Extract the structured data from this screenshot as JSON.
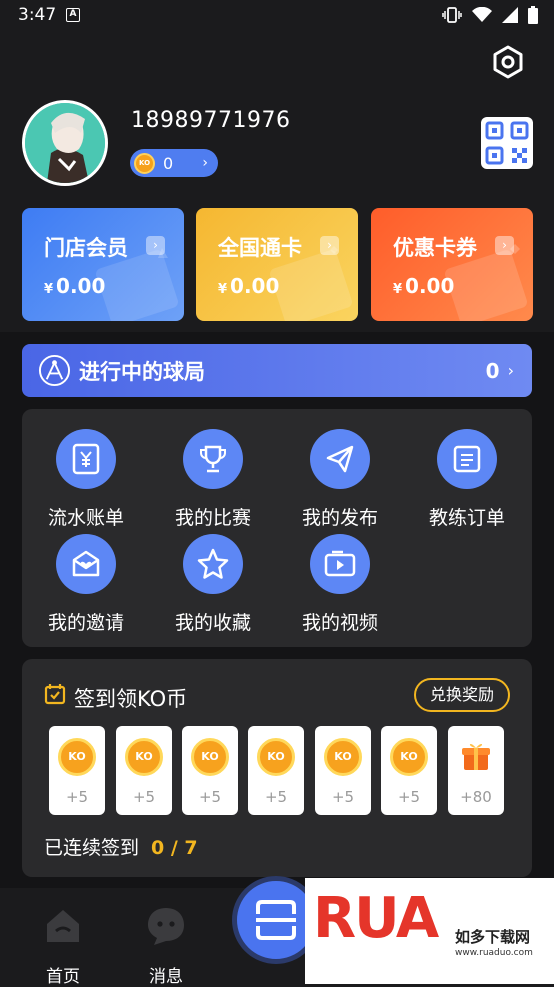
{
  "status_bar": {
    "time": "3:47",
    "badge": "A"
  },
  "profile": {
    "phone": "18989771976",
    "ko_coin_label": "KO",
    "ko_balance": "0",
    "chevron": "›"
  },
  "cards": [
    {
      "title": "门店会员",
      "currency": "¥",
      "amount": "0.00",
      "color": "#3e7cf3"
    },
    {
      "title": "全国通卡",
      "currency": "¥",
      "amount": "0.00",
      "color": "#f5b731"
    },
    {
      "title": "优惠卡券",
      "currency": "¥",
      "amount": "0.00",
      "color": "#ff5d2a"
    }
  ],
  "games_in_progress": {
    "label": "进行中的球局",
    "count": "0",
    "chevron": "›"
  },
  "menu": [
    {
      "label": "流水账单",
      "icon": "bill-icon"
    },
    {
      "label": "我的比赛",
      "icon": "trophy-icon"
    },
    {
      "label": "我的发布",
      "icon": "send-icon"
    },
    {
      "label": "教练订单",
      "icon": "order-icon"
    },
    {
      "label": "我的邀请",
      "icon": "invite-icon"
    },
    {
      "label": "我的收藏",
      "icon": "star-icon"
    },
    {
      "label": "我的视频",
      "icon": "video-icon"
    }
  ],
  "checkin": {
    "title": "签到领KO币",
    "redeem_label": "兑换奖励",
    "days": [
      {
        "coin": "KO",
        "points": "+5"
      },
      {
        "coin": "KO",
        "points": "+5"
      },
      {
        "coin": "KO",
        "points": "+5"
      },
      {
        "coin": "KO",
        "points": "+5"
      },
      {
        "coin": "KO",
        "points": "+5"
      },
      {
        "coin": "KO",
        "points": "+5"
      },
      {
        "coin": "gift",
        "points": "+80"
      }
    ],
    "streak_label": "已连续签到",
    "streak_value": "0 / 7"
  },
  "tabs": [
    {
      "label": "首页",
      "icon": "home-icon"
    },
    {
      "label": "消息",
      "icon": "message-icon"
    }
  ],
  "watermark": {
    "logo": "RUA",
    "text": "如多下载网",
    "url": "www.ruaduo.com"
  },
  "colors": {
    "accent": "#5d87f5",
    "gold": "#f2b620",
    "background": "#1b1b1d"
  }
}
